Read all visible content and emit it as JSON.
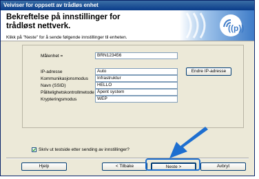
{
  "window": {
    "title": "Veiviser for oppsett av trådløs enhet"
  },
  "header": {
    "title": "Bekreftelse på innstillinger for trådløst nettverk."
  },
  "instruction": "Klikk på \"Neste\" for å sende følgende innstillinger til enheten.",
  "settings": {
    "target_label": "Målenhet =",
    "target_value": "BRN123456",
    "rows": [
      {
        "label": "IP-adresse",
        "value": "Auto"
      },
      {
        "label": "Kommunikasjonsmodus",
        "value": "Infrastruktur"
      },
      {
        "label": "Navn (SSID)",
        "value": "HELLO"
      },
      {
        "label": "Pålitelighetskontrollmetode",
        "value": "Åpent system"
      },
      {
        "label": "Krypteringsmodus",
        "value": "WEP"
      }
    ],
    "change_ip_button": "Endre IP-adresse"
  },
  "checkbox": {
    "label": "Skriv ut testside etter sending av innstillinger?",
    "checked": true
  },
  "buttons": {
    "help": "Hjelp",
    "back": "< Tilbake",
    "next": "Neste >",
    "cancel": "Avbryt"
  },
  "colors": {
    "titlebar": "#0a3c8a",
    "arrow": "#1e6fd0",
    "dialog_bg": "#ece9d8"
  },
  "icons": {
    "banner": "wifi-signal-icon",
    "pointer": "arrow-pointer-icon"
  }
}
